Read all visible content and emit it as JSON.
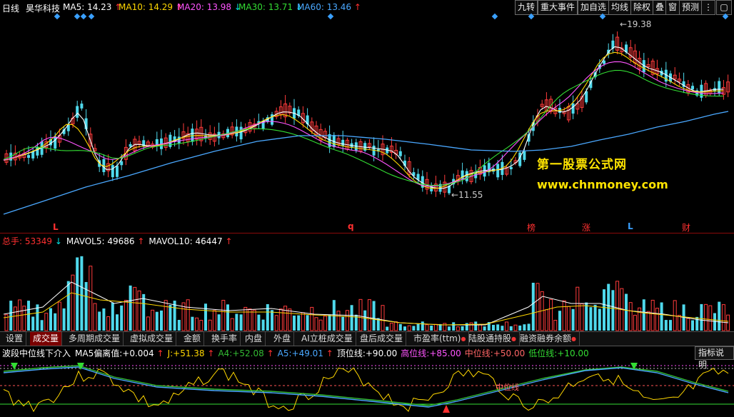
{
  "header": {
    "period": "日线",
    "stock_name": "昊华科技",
    "ma": [
      {
        "label": "MA5:",
        "value": "14.23",
        "color": "#ffffff",
        "arrow": "↑",
        "arrow_color": "#ff3030"
      },
      {
        "label": "MA10:",
        "value": "14.29",
        "color": "#ffd700",
        "arrow": "↑",
        "arrow_color": "#ff3030"
      },
      {
        "label": "MA20:",
        "value": "13.98",
        "color": "#ff55ff",
        "arrow": "↓",
        "arrow_color": "#00e0e0"
      },
      {
        "label": "MA30:",
        "value": "13.71",
        "color": "#33dd33",
        "arrow": "↓",
        "arrow_color": "#00e0e0"
      },
      {
        "label": "MA60:",
        "value": "13.46",
        "color": "#4aa8ff",
        "arrow": "↑",
        "arrow_color": "#ff3030"
      }
    ]
  },
  "toolbar": {
    "buttons": [
      "九转",
      "重大事件",
      "加自选",
      "均线",
      "除权",
      "叠",
      "窗",
      "预测"
    ],
    "more_icon": "vertical-ellipsis-icon"
  },
  "price_chart": {
    "high_label": "19.38",
    "low_label": "11.55",
    "markers": [
      {
        "text": "L",
        "color": "#ff3030"
      },
      {
        "text": "q",
        "color": "#ff3030"
      },
      {
        "text": "榜",
        "color": "#ff3030"
      },
      {
        "text": "涨",
        "color": "#ff3030"
      },
      {
        "text": "L",
        "color": "#3aa0ff"
      },
      {
        "text": "财",
        "color": "#ff3030"
      }
    ]
  },
  "watermark": {
    "line1": "第一股票公式网",
    "line2": "www.chnmoney.com"
  },
  "volume": {
    "items": [
      {
        "label": "总手:",
        "value": "53349",
        "color": "#ff3030",
        "arrow": "↓",
        "arrow_color": "#00e0e0"
      },
      {
        "label": "MAVOL5:",
        "value": "49686",
        "color": "#ffffff",
        "arrow": "↑",
        "arrow_color": "#ff3030"
      },
      {
        "label": "MAVOL10:",
        "value": "46447",
        "color": "#ffffff",
        "arrow": "↑",
        "arrow_color": "#ff3030"
      }
    ]
  },
  "tabs": [
    {
      "label": "设置",
      "dot": false,
      "active": false
    },
    {
      "label": "成交量",
      "dot": false,
      "active": true
    },
    {
      "label": "多周期成交量",
      "dot": false,
      "active": false
    },
    {
      "label": "虚拟成交量",
      "dot": false,
      "active": false
    },
    {
      "label": "金额",
      "dot": false,
      "active": false
    },
    {
      "label": "换手率",
      "dot": false,
      "active": false
    },
    {
      "label": "内盘",
      "dot": false,
      "active": false
    },
    {
      "label": "外盘",
      "dot": false,
      "active": false
    },
    {
      "label": "AI立桩成交量",
      "dot": false,
      "active": false
    },
    {
      "label": "盘后成交量",
      "dot": false,
      "active": false
    },
    {
      "label": "市盈率(ttm)",
      "dot": true,
      "active": false
    },
    {
      "label": "陆股通持股",
      "dot": true,
      "active": false
    },
    {
      "label": "融资融券余额",
      "dot": true,
      "active": false
    }
  ],
  "indicator": {
    "name": "波段中位线下介入",
    "values": [
      {
        "label": "MA5偏离值:",
        "value": "+0.004",
        "color": "#ffffff",
        "arrow": "↑",
        "arrow_color": "#ff3030"
      },
      {
        "label": "J:",
        "value": "+51.38",
        "color": "#ffd700",
        "arrow": "↑",
        "arrow_color": "#ff3030"
      },
      {
        "label": "A4:",
        "value": "+52.08",
        "color": "#33bb33",
        "arrow": "↑",
        "arrow_color": "#ff3030"
      },
      {
        "label": "A5:",
        "value": "+49.01",
        "color": "#4aa8ff",
        "arrow": "↑",
        "arrow_color": "#ff3030"
      },
      {
        "label": "顶位线:",
        "value": "+90.00",
        "color": "#ffffff",
        "arrow": "",
        "arrow_color": "#ffffff"
      },
      {
        "label": "高位线:",
        "value": "+85.00",
        "color": "#ff55ff",
        "arrow": "",
        "arrow_color": "#ffffff"
      },
      {
        "label": "中位线:",
        "value": "+50.00",
        "color": "#ff6666",
        "arrow": "",
        "arrow_color": "#ffffff"
      },
      {
        "label": "低位线:",
        "value": "+10.00",
        "color": "#33dd33",
        "arrow": "",
        "arrow_color": "#ffffff"
      }
    ],
    "help_button": "指标说明",
    "mid_label": "中位线"
  }
}
